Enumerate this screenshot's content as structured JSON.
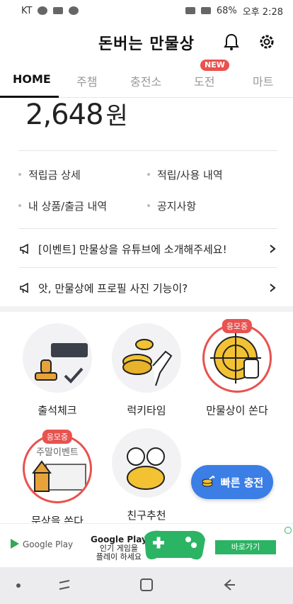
{
  "status": {
    "carrier": "KT",
    "battery": "68%",
    "time": "오후 2:28"
  },
  "app": {
    "title": "돈버는 만물상"
  },
  "tabs": [
    {
      "label": "HOME",
      "active": true
    },
    {
      "label": "주챔"
    },
    {
      "label": "충전소"
    },
    {
      "label": "도전",
      "badge": "NEW"
    },
    {
      "label": "마트"
    }
  ],
  "balance": {
    "amount": "2,648",
    "unit": "원"
  },
  "links": [
    "적립금 상세",
    "적립/사용 내역",
    "내 상품/출금 내역",
    "공지사항"
  ],
  "notices": [
    "[이벤트] 만물상을 유튜브에 소개해주세요!",
    "앗, 만물상에 프로필 사진 기능이?"
  ],
  "features": [
    {
      "label": "출석체크"
    },
    {
      "label": "럭키타임"
    },
    {
      "label": "만물상이 쏜다",
      "tag": "응모중"
    },
    {
      "label": "문상을 쏜다",
      "tag": "응모중",
      "inner_text": "주말이벤트"
    },
    {
      "label": "친구추천"
    }
  ],
  "fab": {
    "label": "빠른 충전"
  },
  "ad": {
    "brand": "Google Play",
    "title": "Google Play",
    "line1": "인기 게임을",
    "line2": "플레이 하세요",
    "cta": "바로가기"
  },
  "colors": {
    "accent": "#e8524f",
    "fab": "#3a7ee6",
    "ad_green": "#2bb463"
  }
}
